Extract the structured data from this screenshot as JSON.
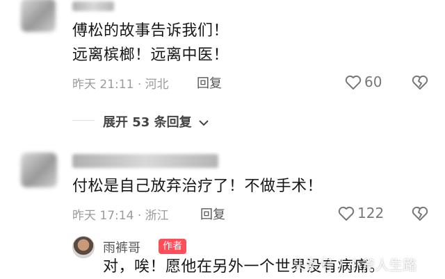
{
  "comments": [
    {
      "text_line1": "傅松的故事告诉我们！",
      "text_line2": "远离槟榔！远离中医！",
      "time": "昨天 21:11",
      "location": "河北",
      "reply_label": "回复",
      "likes": "60",
      "expand_label": "展开 53 条回复"
    },
    {
      "text": "付松是自己放弃治疗了！不做手术！",
      "time": "昨天 17:14",
      "location": "浙江",
      "reply_label": "回复",
      "likes": "122"
    }
  ],
  "author_reply": {
    "name": "雨裤哥",
    "badge": "作者",
    "text": "对，唉！愿他在另外一个世界没有病痛。"
  },
  "watermark": "头条号 / 小斧人生路",
  "colors": {
    "badge": "#ff4d5a",
    "meta": "#9a9a9a"
  }
}
